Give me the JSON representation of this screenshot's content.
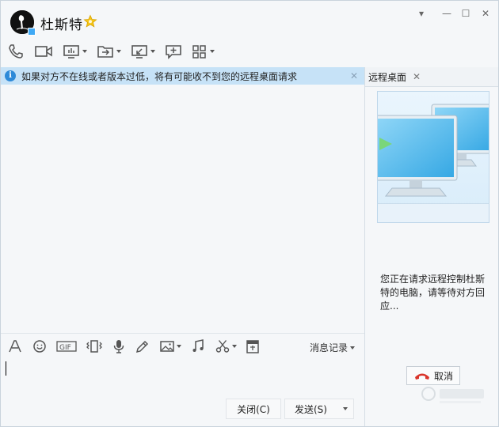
{
  "window": {
    "controls": {
      "dropdown": "▾",
      "minimize": "—",
      "maximize": "☐",
      "close": "✕"
    }
  },
  "header": {
    "contact_name": "杜斯特",
    "icons": [
      "phone-icon",
      "video-icon",
      "screen-share-icon",
      "file-transfer-icon",
      "remote-desktop-icon",
      "message-add-icon",
      "apps-icon"
    ]
  },
  "infobar": {
    "text": "如果对方不在线或者版本过低，将有可能收不到您的远程桌面请求",
    "close": "✕"
  },
  "input_toolbar": {
    "icons": [
      "font-icon",
      "emoji-icon",
      "gif-icon",
      "shake-icon",
      "voice-icon",
      "handwriting-icon",
      "image-icon",
      "music-icon",
      "screenshot-icon",
      "clipboard-icon"
    ],
    "history_label": "消息记录"
  },
  "buttons": {
    "close_label": "关闭(C)",
    "send_label": "发送(S)"
  },
  "right_panel": {
    "tab_label": "远程桌面",
    "tab_close": "✕",
    "status_text": "您正在请求远程控制杜斯特的电脑，请等待对方回应...",
    "cancel_label": "取消"
  },
  "colors": {
    "accent": "#3fa9f5",
    "infobar_bg": "#c6e2f7",
    "window_bg": "#f5f7f9",
    "cancel_icon": "#d9342b",
    "star": "#f5c518"
  }
}
